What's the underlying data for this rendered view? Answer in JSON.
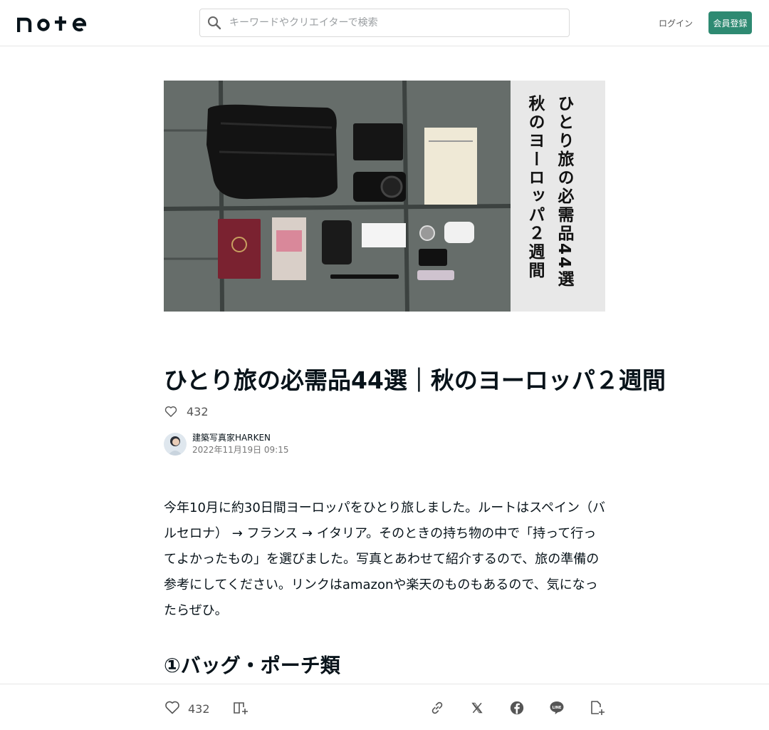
{
  "header": {
    "logo_text": "note",
    "search_placeholder": "キーワードやクリエイターで検索",
    "login_label": "ログイン",
    "signup_label": "会員登録"
  },
  "hero": {
    "caption_line1": "ひとり旅の必需品44選",
    "caption_line2": "秋のヨーロッパ２週間"
  },
  "article": {
    "title": "ひとり旅の必需品44選｜秋のヨーロッパ２週間",
    "likes": "432",
    "author_name": "建築写真家HARKEN",
    "date": "2022年11月19日 09:15",
    "body": "今年10月に約30日間ヨーロッパをひとり旅しました。ルートはスペイン（バルセロナ） → フランス → イタリア。そのときの持ち物の中で「持って行ってよかったもの」を選びました。写真とあわせて紹介するので、旅の準備の参考にしてください。リンクはamazonや楽天のものもあるので、気になったらぜひ。",
    "section1_heading": "①バッグ・ポーチ類"
  },
  "bottom_bar": {
    "likes": "432"
  },
  "colors": {
    "accent": "#2e8a72",
    "text": "#08131a"
  },
  "icons": [
    "search-icon",
    "heart-icon",
    "magazine-add-icon",
    "link-icon",
    "x-icon",
    "facebook-icon",
    "line-icon",
    "note-add-icon"
  ]
}
